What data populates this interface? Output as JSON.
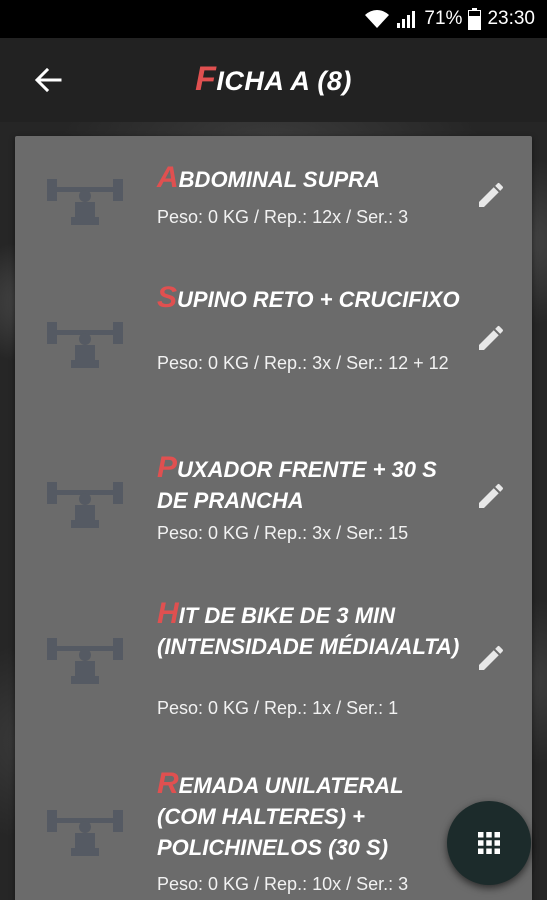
{
  "status_bar": {
    "battery": "71%",
    "time": "23:30",
    "icons": [
      "wifi-icon",
      "signal-icon",
      "battery-icon"
    ]
  },
  "app_bar": {
    "back_icon": "arrow-left-icon",
    "title_first": "F",
    "title_rest": "ICHA A (8)"
  },
  "exercises": [
    {
      "title_first": "A",
      "title_rest": "BDOMINAL SUPRA",
      "detail": "Peso: 0 KG / Rep.: 12x / Ser.: 3",
      "thumb_icon": "weightlifter-icon",
      "edit_icon": "pencil-icon"
    },
    {
      "title_first": "S",
      "title_rest": "UPINO RETO + CRUCIFIXO",
      "detail": "Peso: 0 KG / Rep.: 3x / Ser.: 12 + 12",
      "thumb_icon": "weightlifter-icon",
      "edit_icon": "pencil-icon"
    },
    {
      "title_first": "P",
      "title_rest": "UXADOR FRENTE + 30 S DE PRANCHA",
      "detail": "Peso: 0 KG / Rep.: 3x / Ser.: 15",
      "thumb_icon": "weightlifter-icon",
      "edit_icon": "pencil-icon"
    },
    {
      "title_first": "H",
      "title_rest": "IT DE BIKE DE 3 MIN (INTENSIDADE MÉDIA/ALTA)",
      "detail": "Peso: 0 KG / Rep.: 1x / Ser.: 1",
      "thumb_icon": "weightlifter-icon",
      "edit_icon": "pencil-icon"
    },
    {
      "title_first": "R",
      "title_rest": "EMADA UNILATERAL (COM HALTERES) + POLICHINELOS (30 S)",
      "detail": "Peso: 0 KG / Rep.: 10x / Ser.: 3",
      "thumb_icon": "weightlifter-icon",
      "edit_icon": "pencil-icon"
    }
  ],
  "fab": {
    "icon": "grid-icon"
  },
  "colors": {
    "accent": "#e05050",
    "card": "#6b6b6b",
    "app_bar": "#222222",
    "fab": "#1c2b2b"
  }
}
